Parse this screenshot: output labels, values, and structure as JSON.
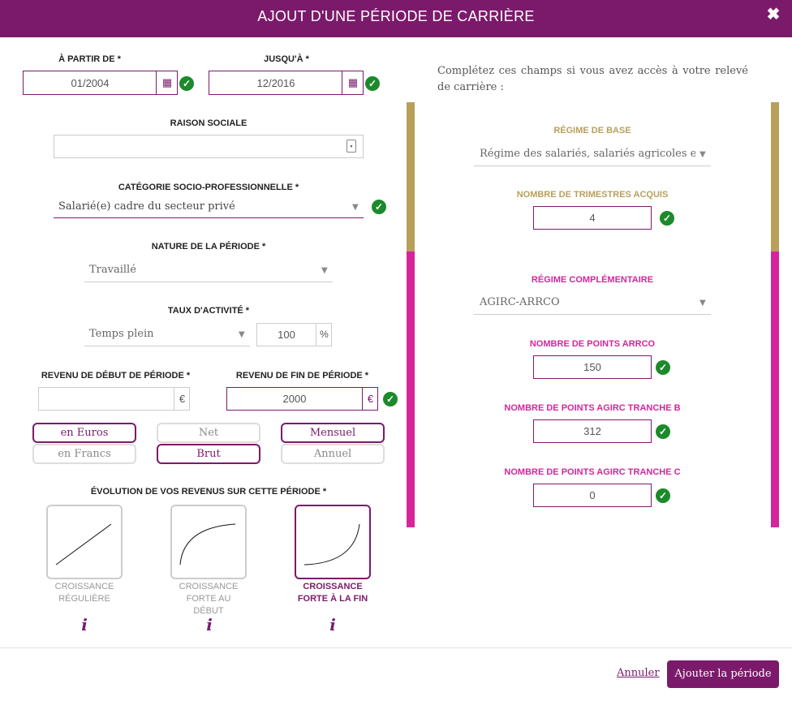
{
  "dialog": {
    "title": "AJOUT D'UNE PÉRIODE DE CARRIÈRE",
    "close_glyph": "✖"
  },
  "start": {
    "label": "À PARTIR DE *",
    "value": "01/2004"
  },
  "end": {
    "label": "JUSQU'À *",
    "value": "12/2016"
  },
  "company": {
    "label": "RAISON SOCIALE",
    "value": ""
  },
  "category": {
    "label": "CATÉGORIE SOCIO-PROFESSIONNELLE *",
    "value": "Salarié(e) cadre du secteur privé"
  },
  "nature": {
    "label": "NATURE DE LA PÉRIODE *",
    "value": "Travaillé"
  },
  "activity": {
    "label": "TAUX D'ACTIVITÉ *",
    "value": "Temps plein",
    "percent": "100",
    "percent_unit": "%"
  },
  "income_start": {
    "label": "REVENU DE DÉBUT DE PÉRIODE *",
    "value": "",
    "unit": "€"
  },
  "income_end": {
    "label": "REVENU DE FIN DE PÉRIODE *",
    "value": "2000",
    "unit": "€"
  },
  "toggles": {
    "euros": "en Euros",
    "francs": "en Francs",
    "net": "Net",
    "brut": "Brut",
    "mensuel": "Mensuel",
    "annuel": "Annuel"
  },
  "evolution": {
    "label": "ÉVOLUTION DE VOS REVENUS SUR CETTE PÉRIODE *",
    "options": [
      {
        "line1": "CROISSANCE",
        "line2": "RÉGULIÈRE",
        "line3": ""
      },
      {
        "line1": "CROISSANCE",
        "line2": "FORTE AU",
        "line3": "DÉBUT"
      },
      {
        "line1": "CROISSANCE",
        "line2": "FORTE À LA FIN",
        "line3": ""
      }
    ],
    "info_glyph": "i"
  },
  "right": {
    "intro": "Complétez ces champs si vous avez accès à votre relevé de carrière :",
    "base_regime": {
      "label": "RÉGIME DE BASE",
      "value": "Régime des salariés, salariés agricoles et trava"
    },
    "quarters": {
      "label": "NOMBRE DE TRIMESTRES ACQUIS",
      "value": "4"
    },
    "comp_regime": {
      "label": "RÉGIME COMPLÉMENTAIRE",
      "value": "AGIRC-ARRCO"
    },
    "arrco": {
      "label": "NOMBRE DE POINTS ARRCO",
      "value": "150"
    },
    "agirc_b": {
      "label": "NOMBRE DE POINTS AGIRC TRANCHE B",
      "value": "312"
    },
    "agirc_c": {
      "label": "NOMBRE DE POINTS AGIRC TRANCHE C",
      "value": "0"
    }
  },
  "footer": {
    "cancel": "Annuler",
    "submit": "Ajouter la période"
  },
  "colors": {
    "brand": "#7b1a6b",
    "gold": "#b8a05a",
    "pink": "#d6259a",
    "check": "#1c8a2b"
  }
}
